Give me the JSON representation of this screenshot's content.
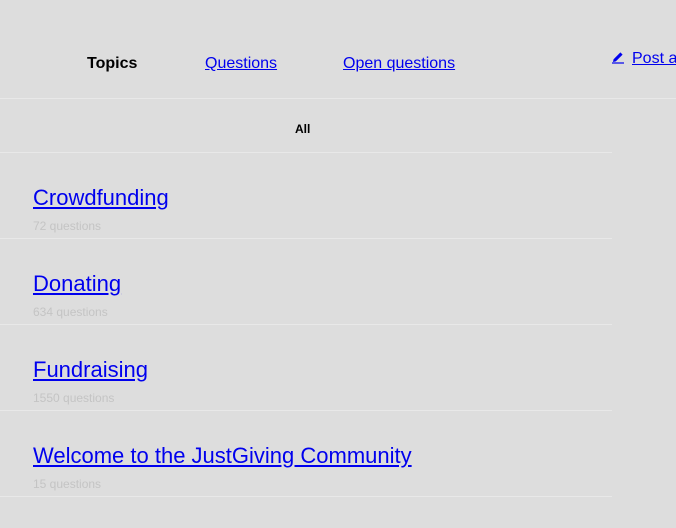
{
  "nav": {
    "tabs": [
      {
        "label": "Topics",
        "active": true
      },
      {
        "label": "Questions",
        "active": false
      },
      {
        "label": "Open questions",
        "active": false
      }
    ],
    "post_label": "Post a",
    "post_icon": "pencil-icon"
  },
  "filter": {
    "label": "All"
  },
  "topics": [
    {
      "title": "Crowdfunding",
      "count": "72 questions"
    },
    {
      "title": "Donating",
      "count": "634 questions"
    },
    {
      "title": "Fundraising",
      "count": "1550 questions"
    },
    {
      "title": "Welcome to the JustGiving Community",
      "count": "15 questions"
    }
  ],
  "colors": {
    "background": "#dddddd",
    "link": "#0000ee",
    "muted": "#c4c4c4",
    "divider": "#e8e8e8"
  }
}
